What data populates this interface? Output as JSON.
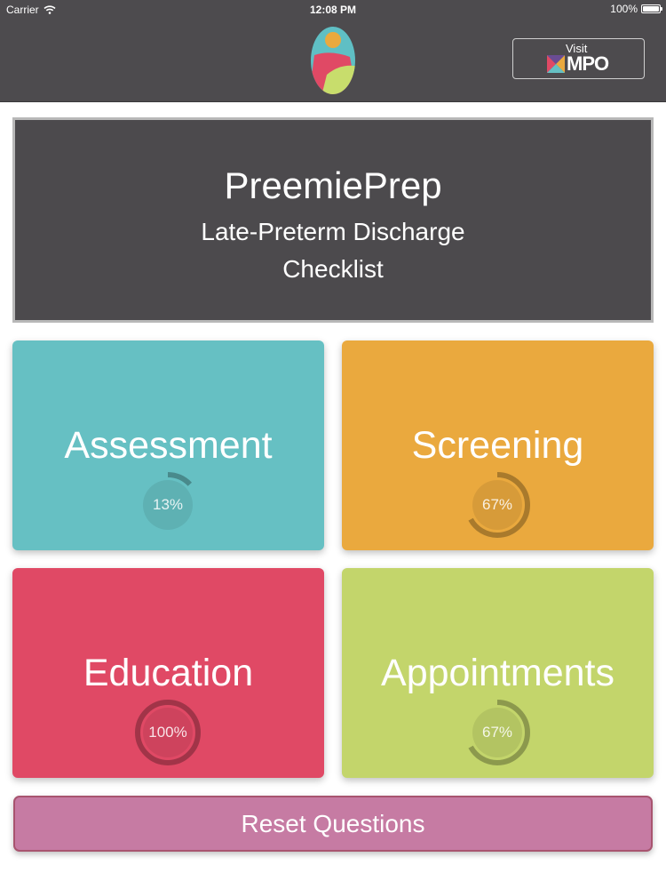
{
  "status_bar": {
    "carrier": "Carrier",
    "time": "12:08 PM",
    "battery": "100%"
  },
  "nav": {
    "visit_label": "Visit",
    "visit_brand": "MPO"
  },
  "header": {
    "title": "PreemiePrep",
    "subtitle": "Late-Preterm Discharge Checklist"
  },
  "tiles": [
    {
      "label": "Assessment",
      "progress": 13,
      "progress_text": "13%",
      "color": "#66c0c3"
    },
    {
      "label": "Screening",
      "progress": 67,
      "progress_text": "67%",
      "color": "#eaa93e"
    },
    {
      "label": "Education",
      "progress": 100,
      "progress_text": "100%",
      "color": "#e04965"
    },
    {
      "label": "Appointments",
      "progress": 67,
      "progress_text": "67%",
      "color": "#c3d56b"
    }
  ],
  "reset_label": "Reset Questions",
  "colors": {
    "bar": "#4d4b4e",
    "reset": "#c67ba3"
  }
}
